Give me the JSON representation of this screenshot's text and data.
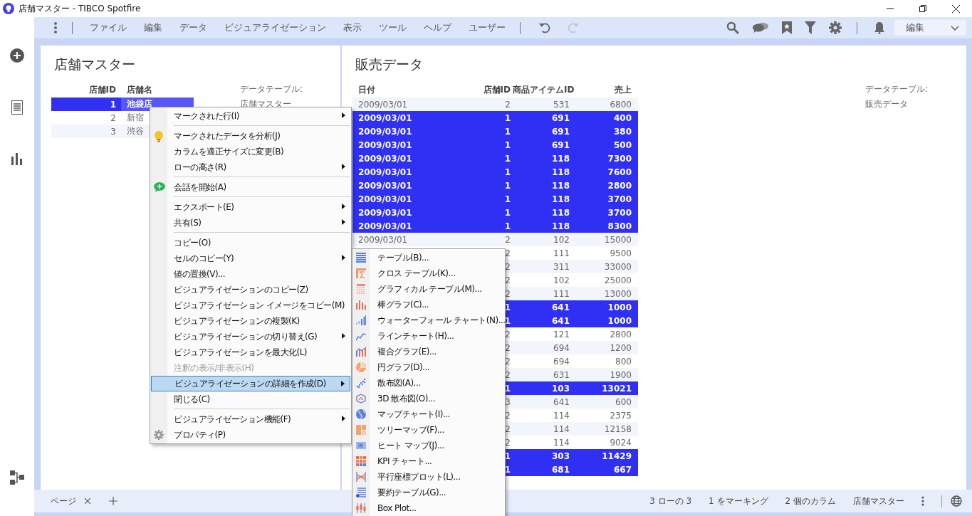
{
  "window": {
    "title": "店舗マスター - TIBCO Spotfire"
  },
  "toolbar": {
    "menus": [
      "ファイル",
      "編集",
      "データ",
      "ビジュアライゼーション",
      "表示",
      "ツール",
      "ヘルプ",
      "ユーザー"
    ],
    "history": [
      {
        "kind": "undo",
        "disabled": false
      },
      {
        "kind": "redo",
        "disabled": true
      }
    ],
    "mode_dropdown": {
      "value": "編集"
    }
  },
  "store_panel": {
    "title": "店舗マスター",
    "columns": [
      "店舗ID",
      "店舗名"
    ],
    "rows": [
      {
        "id": "1",
        "name": "池袋店",
        "selected": true
      },
      {
        "id": "2",
        "name": "新宿",
        "selected": false
      },
      {
        "id": "3",
        "name": "渋谷",
        "selected": false
      }
    ],
    "data_table": {
      "label": "データテーブル:",
      "value": "店舗マスター"
    }
  },
  "sales_panel": {
    "title": "販売データ",
    "columns": [
      "日付",
      "店舗ID",
      "商品アイテムID",
      "売上"
    ],
    "rows": [
      {
        "date": "2009/03/01",
        "store_id": "2",
        "item_id": "531",
        "sales": "6800",
        "selected": false
      },
      {
        "date": "2009/03/01",
        "store_id": "1",
        "item_id": "691",
        "sales": "400",
        "selected": true
      },
      {
        "date": "2009/03/01",
        "store_id": "1",
        "item_id": "691",
        "sales": "380",
        "selected": true
      },
      {
        "date": "2009/03/01",
        "store_id": "1",
        "item_id": "691",
        "sales": "500",
        "selected": true
      },
      {
        "date": "2009/03/01",
        "store_id": "1",
        "item_id": "118",
        "sales": "7300",
        "selected": true
      },
      {
        "date": "2009/03/01",
        "store_id": "1",
        "item_id": "118",
        "sales": "7600",
        "selected": true
      },
      {
        "date": "2009/03/01",
        "store_id": "1",
        "item_id": "118",
        "sales": "2800",
        "selected": true
      },
      {
        "date": "2009/03/01",
        "store_id": "1",
        "item_id": "118",
        "sales": "3700",
        "selected": true
      },
      {
        "date": "2009/03/01",
        "store_id": "1",
        "item_id": "118",
        "sales": "3700",
        "selected": true
      },
      {
        "date": "2009/03/01",
        "store_id": "1",
        "item_id": "118",
        "sales": "8300",
        "selected": true
      },
      {
        "date": "2009/03/01",
        "store_id": "2",
        "item_id": "102",
        "sales": "15000",
        "selected": false
      },
      {
        "store_id": "2",
        "item_id": "111",
        "sales": "9500",
        "selected": false
      },
      {
        "store_id": "2",
        "item_id": "311",
        "sales": "33000",
        "selected": false
      },
      {
        "store_id": "2",
        "item_id": "102",
        "sales": "25000",
        "selected": false
      },
      {
        "store_id": "2",
        "item_id": "111",
        "sales": "13000",
        "selected": false
      },
      {
        "store_id": "1",
        "item_id": "641",
        "sales": "1000",
        "selected": true
      },
      {
        "store_id": "1",
        "item_id": "641",
        "sales": "1000",
        "selected": true
      },
      {
        "store_id": "2",
        "item_id": "121",
        "sales": "2800",
        "selected": false
      },
      {
        "store_id": "2",
        "item_id": "694",
        "sales": "1200",
        "selected": false
      },
      {
        "store_id": "2",
        "item_id": "694",
        "sales": "800",
        "selected": false
      },
      {
        "store_id": "2",
        "item_id": "631",
        "sales": "1900",
        "selected": false
      },
      {
        "store_id": "1",
        "item_id": "103",
        "sales": "13021",
        "selected": true
      },
      {
        "store_id": "3",
        "item_id": "641",
        "sales": "600",
        "selected": false
      },
      {
        "store_id": "2",
        "item_id": "114",
        "sales": "2375",
        "selected": false
      },
      {
        "store_id": "2",
        "item_id": "114",
        "sales": "12158",
        "selected": false
      },
      {
        "store_id": "2",
        "item_id": "114",
        "sales": "9024",
        "selected": false
      },
      {
        "store_id": "1",
        "item_id": "303",
        "sales": "11429",
        "selected": true
      },
      {
        "store_id": "1",
        "item_id": "681",
        "sales": "667",
        "selected": true
      }
    ],
    "data_table": {
      "label": "データテーブル:",
      "value": "販売データ"
    }
  },
  "context_menu": {
    "items": [
      {
        "kind": "item",
        "label": "マークされた行(I)",
        "submenu": true,
        "disabled": false,
        "selected": false
      },
      {
        "kind": "separator"
      },
      {
        "kind": "item",
        "label": "マークされたデータを分析(J)",
        "submenu": false,
        "disabled": false,
        "selected": false
      },
      {
        "kind": "item",
        "label": "カラムを適正サイズに変更(B)",
        "submenu": false,
        "disabled": false,
        "selected": false
      },
      {
        "kind": "item",
        "label": "ローの高さ(R)",
        "submenu": true,
        "disabled": false,
        "selected": false
      },
      {
        "kind": "separator"
      },
      {
        "kind": "item",
        "label": "会話を開始(A)",
        "submenu": false,
        "disabled": false,
        "selected": false
      },
      {
        "kind": "separator"
      },
      {
        "kind": "item",
        "label": "エクスポート(E)",
        "submenu": true,
        "disabled": false,
        "selected": false
      },
      {
        "kind": "item",
        "label": "共有(S)",
        "submenu": true,
        "disabled": false,
        "selected": false
      },
      {
        "kind": "separator"
      },
      {
        "kind": "item",
        "label": "コピー(O)",
        "submenu": false,
        "disabled": false,
        "selected": false
      },
      {
        "kind": "item",
        "label": "セルのコピー(Y)",
        "submenu": true,
        "disabled": false,
        "selected": false
      },
      {
        "kind": "item",
        "label": "値の置換(V)...",
        "submenu": false,
        "disabled": false,
        "selected": false
      },
      {
        "kind": "item",
        "label": "ビジュアライゼーションのコピー(Z)",
        "submenu": false,
        "disabled": false,
        "selected": false
      },
      {
        "kind": "item",
        "label": "ビジュアライゼーション イメージをコピー(M)",
        "submenu": false,
        "disabled": false,
        "selected": false
      },
      {
        "kind": "item",
        "label": "ビジュアライゼーションの複製(K)",
        "submenu": false,
        "disabled": false,
        "selected": false
      },
      {
        "kind": "item",
        "label": "ビジュアライゼーションの切り替え(G)",
        "submenu": true,
        "disabled": false,
        "selected": false
      },
      {
        "kind": "item",
        "label": "ビジュアライゼーションを最大化(L)",
        "submenu": false,
        "disabled": false,
        "selected": false
      },
      {
        "kind": "item",
        "label": "注釈の表示/非表示(H)",
        "submenu": false,
        "disabled": true,
        "selected": false
      },
      {
        "kind": "item",
        "label": "ビジュアライゼーションの詳細を作成(D)",
        "submenu": true,
        "disabled": false,
        "selected": true
      },
      {
        "kind": "item",
        "label": "閉じる(C)",
        "submenu": false,
        "disabled": false,
        "selected": false
      },
      {
        "kind": "separator"
      },
      {
        "kind": "item",
        "label": "ビジュアライゼーション機能(F)",
        "submenu": true,
        "disabled": false,
        "selected": false
      },
      {
        "kind": "item",
        "label": "プロパティ(P)",
        "submenu": false,
        "disabled": false,
        "selected": false
      }
    ]
  },
  "submenu": {
    "items": [
      "テーブル(B)...",
      "クロス テーブル(K)...",
      "グラフィカル テーブル(M)...",
      "棒グラフ(C)...",
      "ウォーターフォール チャート(N)...",
      "ラインチャート(H)...",
      "複合グラフ(E)...",
      "円グラフ(D)...",
      "散布図(A)...",
      "3D 散布図(O)...",
      "マップチャート(I)...",
      "ツリーマップ(F)...",
      "ヒート マップ(J)...",
      "KPI チャート...",
      "平行座標プロット(L)...",
      "要約テーブル(G)...",
      "Box Plot..."
    ]
  },
  "page_tabs": [
    {
      "label": "ページ"
    }
  ],
  "status_bar": {
    "items": [
      "3 ローの 3",
      "1 をマーキング",
      "2 個のカラム",
      "店舗マスター"
    ]
  }
}
